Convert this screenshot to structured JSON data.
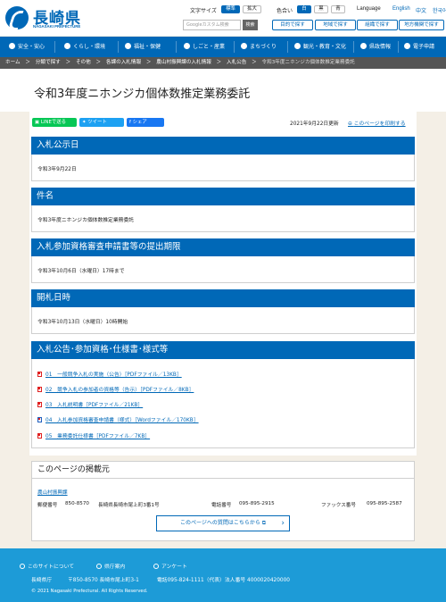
{
  "header": {
    "logo_name": "長崎県",
    "logo_sub": "NAGASAKI PREFECTURE",
    "text_size_label": "文字サイズ",
    "text_size_standard": "標準",
    "text_size_large": "拡大",
    "color_label": "色合い",
    "color_white": "白",
    "color_black": "黒",
    "color_blue": "青",
    "language_label": "Language",
    "lang_english": "English",
    "lang_chinese": "中文",
    "lang_korean": "한국어",
    "search_placeholder": "Googleカスタム検索",
    "search_button": "検索",
    "quick_links": [
      "目的で探す",
      "地域で探す",
      "組織で探す",
      "地方機関で探す"
    ]
  },
  "nav": {
    "items": [
      "安全・安心",
      "くらし・環境",
      "福祉・保健",
      "しごと・産業",
      "まちづくり",
      "観光・教育・文化",
      "県政情報",
      "電子申請"
    ]
  },
  "breadcrumb": [
    "ホーム",
    "分類で探す",
    "その他",
    "各課の入札情報",
    "農山村振興課の入札情報",
    "入札公告",
    "令和3年度ニホンジカ個体数推定業務委託"
  ],
  "page": {
    "title": "令和3年度ニホンジカ個体数推定業務委託",
    "share_line": "LINEで送る",
    "share_tweet": "ツイート",
    "share_facebook": "シェア",
    "updated": "2021年9月22日更新",
    "print": "このページを印刷する"
  },
  "sections": [
    {
      "heading": "入札公示日",
      "text": "令和3年9月22日"
    },
    {
      "heading": "件名",
      "text": "令和3年度ニホンジカ個体数推定業務委託"
    },
    {
      "heading": "入札参加資格審査申請書等の提出期限",
      "text": "令和3年10月6日（水曜日）17時まで"
    },
    {
      "heading": "開札日時",
      "text": "令和3年10月13日（水曜日）10時開始"
    },
    {
      "heading": "入札公告･参加資格･仕様書･様式等"
    }
  ],
  "files": [
    "01　一般競争入札の実施（公告）［PDFファイル／13KB］",
    "02　競争入札の参加者の資格等（告示）［PDFファイル／8KB］",
    "03　入札説明書［PDFファイル／21KB］",
    "04　入札参加資格審査申請書（様式）［Wordファイル／170KB］",
    "05　業務委託仕様書［PDFファイル／7KB］"
  ],
  "contact": {
    "heading": "このページの掲載元",
    "dept": "農山村振興課",
    "postal_label": "郵便番号",
    "postal": "850-8570",
    "address": "長崎県長崎市尾上町3番1号",
    "phone_label": "電話番号",
    "phone": "095-895-2915",
    "fax_label": "ファックス番号",
    "fax": "095-895-2587",
    "inquiry_button": "このページへの質問はこちらから"
  },
  "footer": {
    "links": [
      "このサイトについて",
      "県庁案内",
      "アンケート"
    ],
    "org": "長崎県庁",
    "address": "〒850-8570 長崎市尾上町3-1",
    "phone": "電話095-824-1111（代表）",
    "corp_no": "法人番号 4000020420000",
    "copyright": "© 2021 Nagasaki Prefectural. All Rights Reserved."
  },
  "colors": {
    "brand": "#0068b7",
    "footer": "#1d9bd7",
    "line": "#06c755",
    "twitter": "#1da1f2",
    "facebook": "#1877f2"
  }
}
